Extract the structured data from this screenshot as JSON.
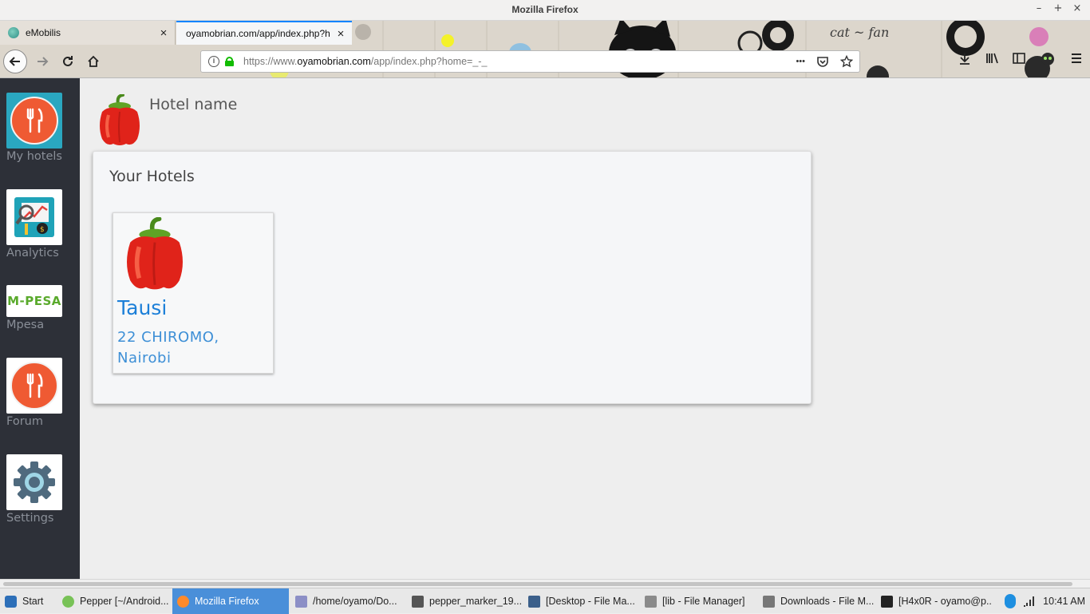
{
  "window": {
    "title": "Mozilla Firefox",
    "controls": [
      "–",
      "+",
      "×"
    ]
  },
  "tabs": [
    {
      "label": "eMobilis",
      "close": "×"
    },
    {
      "label": "oyamobrian.com/app/index.php?h",
      "close": "×"
    }
  ],
  "urlbar": {
    "url_prefix": "https://www.",
    "url_domain": "oyamobrian.com",
    "url_path": "/app/index.php?home=_-_",
    "more": "•••"
  },
  "sidebar": {
    "items": [
      {
        "label": "My hotels"
      },
      {
        "label": "Analytics"
      },
      {
        "label": "Mpesa",
        "logo_text": "M-PESA"
      },
      {
        "label": "Forum"
      },
      {
        "label": "Settings"
      }
    ]
  },
  "header": {
    "hotel_name": "Hotel name"
  },
  "panel": {
    "title": "Your Hotels",
    "hotels": [
      {
        "name": "Tausi",
        "address": "22 CHIROMO, Nairobi"
      }
    ]
  },
  "taskbar": {
    "start": "Start",
    "items": [
      "Pepper [~/Android...",
      "Mozilla Firefox",
      "/home/oyamo/Do...",
      "pepper_marker_19...",
      "[Desktop - File Ma...",
      "[lib - File Manager]",
      "Downloads - File M...",
      "[H4x0R - oyamo@p..."
    ],
    "clock": "10:41 AM"
  },
  "colors": {
    "sidebar_bg": "#2d3038",
    "selected_tile": "#2aa7c0",
    "fork_circle": "#ef5a33",
    "link_blue": "#1c7fd8",
    "taskbar_active": "#4a8fd9"
  }
}
